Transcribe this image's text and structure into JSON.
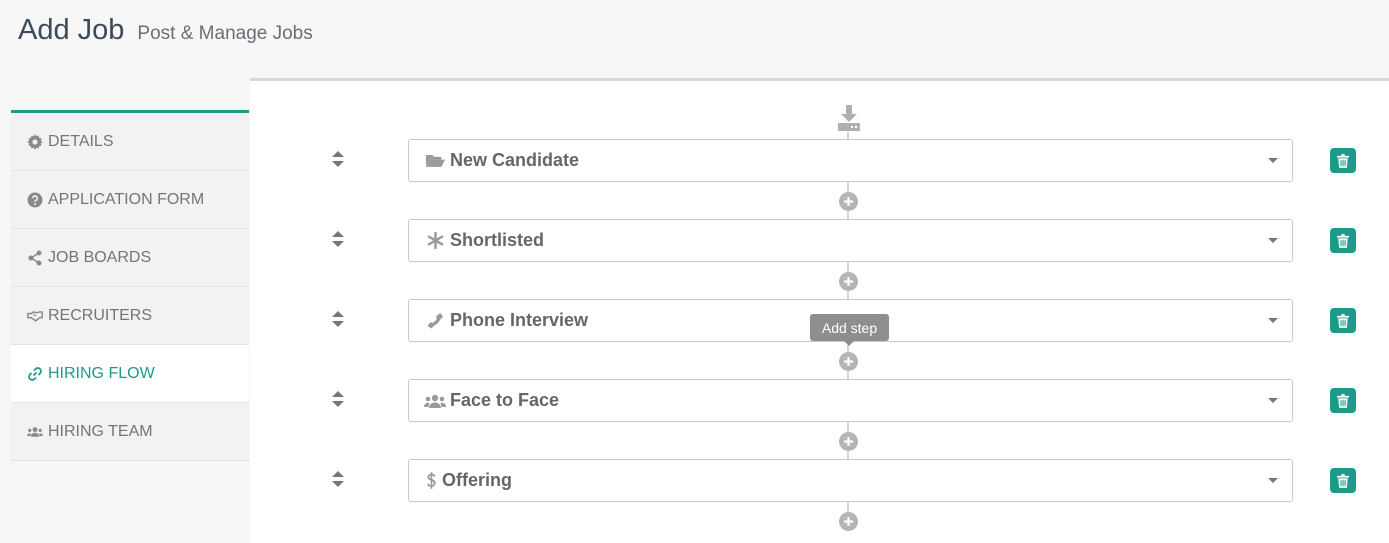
{
  "header": {
    "title": "Add Job",
    "subtitle": "Post & Manage Jobs"
  },
  "sidebar": {
    "items": [
      {
        "label": "DETAILS",
        "icon": "gear-icon",
        "active": false
      },
      {
        "label": "APPLICATION FORM",
        "icon": "question-circle-icon",
        "active": false
      },
      {
        "label": "JOB BOARDS",
        "icon": "share-icon",
        "active": false
      },
      {
        "label": "RECRUITERS",
        "icon": "handshake-icon",
        "active": false
      },
      {
        "label": "HIRING FLOW",
        "icon": "link-icon",
        "active": true
      },
      {
        "label": "HIRING TEAM",
        "icon": "users-icon",
        "active": false
      }
    ]
  },
  "flow": {
    "start_icon": "download-icon",
    "steps": [
      {
        "label": "New Candidate",
        "icon": "folder-open-icon"
      },
      {
        "label": "Shortlisted",
        "icon": "asterisk-icon"
      },
      {
        "label": "Phone Interview",
        "icon": "phone-icon"
      },
      {
        "label": "Face to Face",
        "icon": "users-icon"
      },
      {
        "label": "Offering",
        "icon": "dollar-icon"
      }
    ],
    "tooltip": "Add step"
  },
  "colors": {
    "accent": "#1c9b8b",
    "text": "#666666",
    "muted": "#b5b5b5"
  }
}
